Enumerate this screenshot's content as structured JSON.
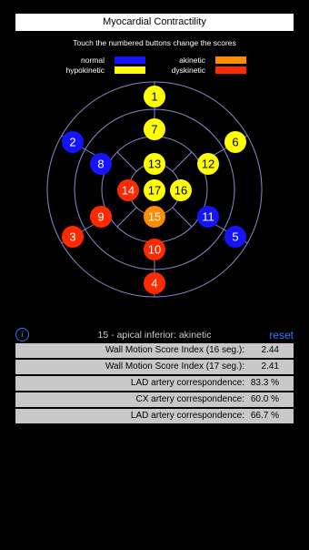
{
  "header": {
    "title": "Myocardial Contractility"
  },
  "instructions": "Touch the numbered buttons change the scores",
  "legend": [
    {
      "label": "normal",
      "color": "#1414ff"
    },
    {
      "label": "akinetic",
      "color": "#ff8c00"
    },
    {
      "label": "hypokinetic",
      "color": "#ffff00"
    },
    {
      "label": "dyskinetic",
      "color": "#ff2a00"
    }
  ],
  "segments": [
    {
      "number": "1",
      "score": "hypokinetic"
    },
    {
      "number": "2",
      "score": "normal"
    },
    {
      "number": "3",
      "score": "dyskinetic"
    },
    {
      "number": "4",
      "score": "dyskinetic"
    },
    {
      "number": "5",
      "score": "normal"
    },
    {
      "number": "6",
      "score": "hypokinetic"
    },
    {
      "number": "7",
      "score": "hypokinetic"
    },
    {
      "number": "8",
      "score": "normal"
    },
    {
      "number": "9",
      "score": "dyskinetic"
    },
    {
      "number": "10",
      "score": "dyskinetic"
    },
    {
      "number": "11",
      "score": "normal"
    },
    {
      "number": "12",
      "score": "hypokinetic"
    },
    {
      "number": "13",
      "score": "hypokinetic"
    },
    {
      "number": "14",
      "score": "dyskinetic"
    },
    {
      "number": "15",
      "score": "akinetic"
    },
    {
      "number": "16",
      "score": "hypokinetic"
    },
    {
      "number": "17",
      "score": "hypokinetic"
    }
  ],
  "score_colors": {
    "normal": "#1414ff",
    "hypokinetic": "#ffff00",
    "akinetic": "#ff8c00",
    "dyskinetic": "#ff2a00"
  },
  "status": {
    "info_icon": "info-icon",
    "selected_text": "15 - apical inferior: akinetic",
    "reset_label": "reset"
  },
  "results": [
    {
      "label": "Wall Motion Score Index (16 seg.):",
      "value": "2.44"
    },
    {
      "label": "Wall Motion Score Index (17 seg.):",
      "value": "2.41"
    },
    {
      "label": "LAD artery correspondence:",
      "value": "83.3 %"
    },
    {
      "label": "CX artery correspondence:",
      "value": "60.0 %"
    },
    {
      "label": "LAD artery correspondence:",
      "value": "66.7 %"
    }
  ]
}
